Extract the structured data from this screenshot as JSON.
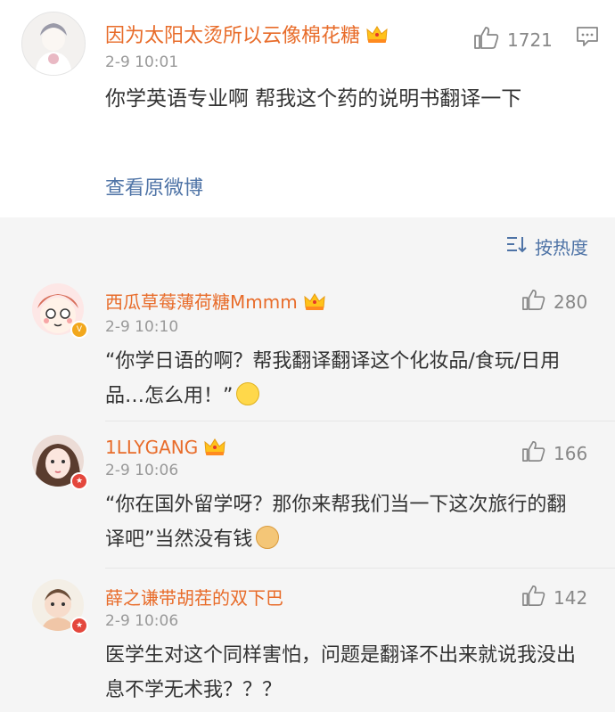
{
  "post": {
    "username": "因为太阳太烫所以云像棉花糖",
    "time": "2-9 10:01",
    "like_count": "1721",
    "text": "你学英语专业啊 帮我这个药的说明书翻译一下",
    "view_original": "查看原微博"
  },
  "sort_label": "按热度",
  "comments": [
    {
      "username": "西瓜草莓薄荷糖Mmmm",
      "time": "2-9 10:10",
      "likes": "280",
      "text": "“你学日语的啊？帮我翻译翻译这个化妆品/食玩/日用品…怎么用！”"
    },
    {
      "username": "1LLYGANG",
      "time": "2-9 10:06",
      "likes": "166",
      "text": "“你在国外留学呀？那你来帮我们当一下这次旅行的翻译吧”当然没有钱"
    },
    {
      "username": "薛之谦带胡茬的双下巴",
      "time": "2-9 10:06",
      "likes": "142",
      "text": "医学生对这个同样害怕，问题是翻译不出来就说我没出息不学无术我？？？"
    }
  ],
  "colors": {
    "username": "#e86c2a",
    "link": "#4e73a6",
    "meta": "#999999"
  }
}
